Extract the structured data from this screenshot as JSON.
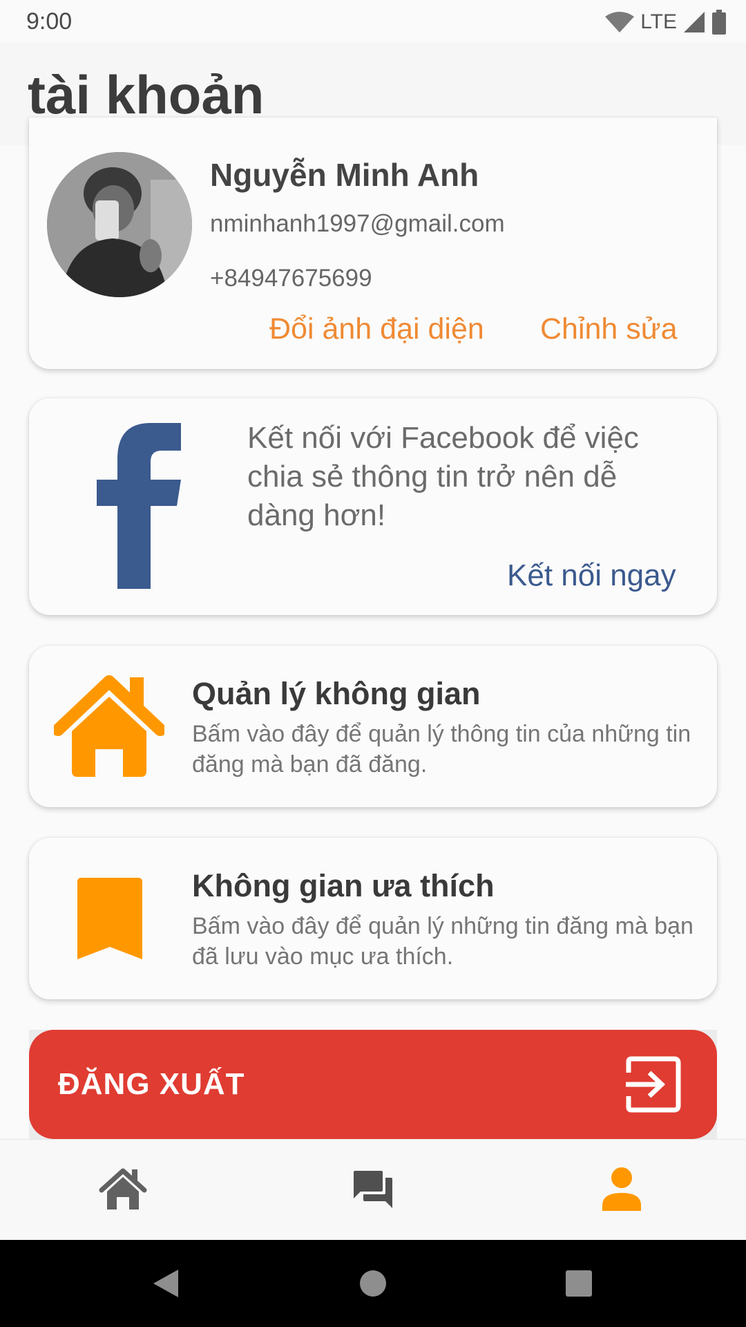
{
  "status_bar": {
    "time": "9:00",
    "network": "LTE"
  },
  "app_bar": {
    "title": "tài khoản"
  },
  "profile": {
    "name": "Nguyễn Minh Anh",
    "email": "nminhanh1997@gmail.com",
    "phone": "+84947675699",
    "change_avatar_label": "Đổi ảnh đại diện",
    "edit_label": "Chỉnh sửa"
  },
  "facebook": {
    "message": "Kết nối với Facebook để việc chia sẻ thông tin trở nên dễ dàng hơn!",
    "connect_label": "Kết nối ngay"
  },
  "menu": [
    {
      "icon": "house-icon",
      "title": "Quản lý không gian",
      "description": "Bấm vào đây để quản lý thông tin của những tin đăng mà bạn đã đăng."
    },
    {
      "icon": "bookmark-icon",
      "title": "Không gian ưa thích",
      "description": "Bấm vào đây để quản lý những tin đăng mà bạn đã lưu vào mục ưa thích."
    }
  ],
  "logout": {
    "label": "ĐĂNG XUẤT",
    "icon": "logout-icon"
  },
  "bottom_nav": {
    "items": [
      {
        "icon": "home-icon",
        "active": false
      },
      {
        "icon": "chat-icon",
        "active": false
      },
      {
        "icon": "account-icon",
        "active": true
      }
    ]
  },
  "colors": {
    "accent_orange": "#ef8a34",
    "icon_orange": "#ff9800",
    "facebook_blue": "#3b5a8e",
    "logout_red": "#e03c32"
  }
}
